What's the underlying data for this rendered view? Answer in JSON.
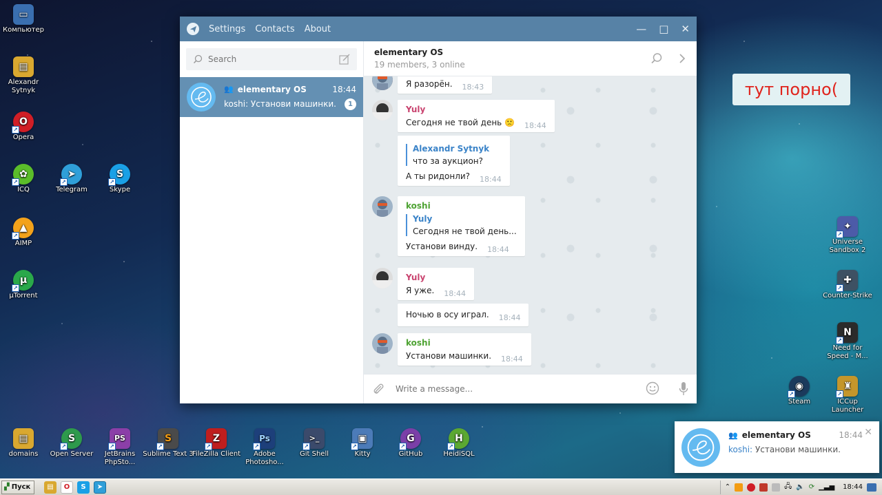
{
  "desktop": {
    "icons_left": [
      {
        "label": "Компьютер",
        "color": "#3a6fb0",
        "glyph": "▭"
      },
      {
        "label": "Alexandr Sytnyk",
        "color": "#d9a830",
        "glyph": "▤"
      },
      {
        "label": "Opera",
        "color": "#d01e26",
        "glyph": "O"
      },
      {
        "label": "ICQ",
        "color": "#5bbd2a",
        "glyph": "✿"
      },
      {
        "label": "Telegram",
        "color": "#2f9fd9",
        "glyph": "➤"
      },
      {
        "label": "Skype",
        "color": "#1aa0e6",
        "glyph": "S"
      },
      {
        "label": "AIMP",
        "color": "#f3a21b",
        "glyph": "▲"
      },
      {
        "label": "µTorrent",
        "color": "#2aa84a",
        "glyph": "µ"
      }
    ],
    "icons_right": [
      {
        "label": "Universe Sandbox 2",
        "color": "#4c5ba8",
        "glyph": "✦"
      },
      {
        "label": "Counter-Strike",
        "color": "#3e5163",
        "glyph": "✚"
      },
      {
        "label": "Need for Speed - M...",
        "color": "#2b2b2b",
        "glyph": "N"
      },
      {
        "label": "Steam",
        "color": "#1b3a5c",
        "glyph": "◉"
      },
      {
        "label": "ICCup Launcher",
        "color": "#c4962b",
        "glyph": "♜"
      }
    ],
    "icons_bottom": [
      {
        "label": "domains",
        "color": "#d9a830",
        "glyph": "▤"
      },
      {
        "label": "Open Server",
        "color": "#2e9a4c",
        "glyph": "S"
      },
      {
        "label": "JetBrains PhpSto...",
        "color": "#8b3fa8",
        "glyph": "PS"
      },
      {
        "label": "Sublime Text 3",
        "color": "#4a4a4a",
        "glyph": "S"
      },
      {
        "label": "FileZilla Client",
        "color": "#bf1e1e",
        "glyph": "Z"
      },
      {
        "label": "Adobe Photosho...",
        "color": "#1d3f7a",
        "glyph": "Ps"
      },
      {
        "label": "Git Shell",
        "color": "#3b4a6b",
        "glyph": ">_"
      },
      {
        "label": "Kitty",
        "color": "#4c7bb8",
        "glyph": "▣"
      },
      {
        "label": "GitHub",
        "color": "#7b3fa8",
        "glyph": "G"
      },
      {
        "label": "HeidiSQL",
        "color": "#5ba832",
        "glyph": "H"
      }
    ],
    "note": "тут порно("
  },
  "telegram": {
    "menu": [
      "Settings",
      "Contacts",
      "About"
    ],
    "window_controls": {
      "minimize": "—",
      "maximize": "□",
      "close": "✕"
    },
    "search_placeholder": "Search",
    "dialog": {
      "name": "elementary OS",
      "time": "18:44",
      "preview_author": "koshi",
      "preview_text": "Установи машинки.",
      "unread": "1"
    },
    "chat": {
      "title": "elementary OS",
      "subtitle": "19 members, 3 online"
    },
    "messages": [
      {
        "text": "Я разорён.",
        "time": "18:43"
      },
      {
        "author": "Yuly",
        "text": "Сегодня не твой день 🙁",
        "time": "18:44"
      },
      {
        "reply_author": "Alexandr Sytnyk",
        "reply_text": "что за аукцион?",
        "text": "А ты ридонли?",
        "time": "18:44"
      },
      {
        "author": "koshi",
        "reply_author": "Yuly",
        "reply_text": "Сегодня не твой день...",
        "text": "Установи винду.",
        "time": "18:44"
      },
      {
        "author": "Yuly",
        "text": "Я уже.",
        "time": "18:44"
      },
      {
        "text": "Ночью в осу играл.",
        "time": "18:44"
      },
      {
        "author": "koshi",
        "text": "Установи машинки.",
        "time": "18:44"
      }
    ],
    "compose_placeholder": "Write a message..."
  },
  "notification": {
    "title": "elementary OS",
    "time": "18:44",
    "author": "koshi:",
    "text": "Установи машинки."
  },
  "taskbar": {
    "start_label": "Пуск",
    "clock": "18:44"
  },
  "colors": {
    "titlebar": "#5782a6",
    "selected_dialog": "#6490b3",
    "yuly": "#c9436f",
    "koshi": "#4ea333",
    "reply": "#3a83c8"
  }
}
